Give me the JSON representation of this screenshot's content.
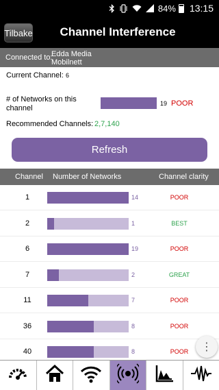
{
  "status_bar": {
    "battery": "84%",
    "time": "13:15",
    "icons": [
      "bluetooth-icon",
      "vibrate-icon",
      "wifi-icon",
      "signal-icon",
      "battery-icon"
    ]
  },
  "nav": {
    "back_label": "Tilbake",
    "title": "Channel Interference"
  },
  "connection": {
    "label": "Connected to:",
    "network": "Edda Media Mobilnett"
  },
  "current_channel": {
    "label": "Current Channel:",
    "value": "6"
  },
  "networks_on_channel": {
    "label": "# of Networks on this channel",
    "count": "19",
    "status": "POOR",
    "fill": 0.95
  },
  "recommended": {
    "label": "Recommended Channels:",
    "value": "2,7,140"
  },
  "refresh_label": "Refresh",
  "table": {
    "headers": [
      "Channel",
      "Number of Networks",
      "Channel clarity"
    ],
    "max_networks": 14,
    "rows": [
      {
        "channel": "1",
        "networks": "14",
        "clarity": "POOR"
      },
      {
        "channel": "2",
        "networks": "1",
        "clarity": "BEST"
      },
      {
        "channel": "6",
        "networks": "19",
        "clarity": "POOR"
      },
      {
        "channel": "7",
        "networks": "2",
        "clarity": "GREAT"
      },
      {
        "channel": "11",
        "networks": "7",
        "clarity": "POOR"
      },
      {
        "channel": "36",
        "networks": "8",
        "clarity": "POOR"
      },
      {
        "channel": "40",
        "networks": "8",
        "clarity": "POOR"
      }
    ]
  },
  "colors": {
    "accent": "#7b62a3",
    "accent_light": "#c7bbd9",
    "poor": "#d20000",
    "good": "#2fa34e",
    "header_bg": "#6c6c6c"
  },
  "tabs": [
    {
      "icon": "speedometer-icon",
      "active": false
    },
    {
      "icon": "home-icon",
      "active": false
    },
    {
      "icon": "wifi-icon",
      "active": false
    },
    {
      "icon": "interference-icon",
      "active": true
    },
    {
      "icon": "graph-icon",
      "active": false
    },
    {
      "icon": "signal-wave-icon",
      "active": false
    }
  ]
}
